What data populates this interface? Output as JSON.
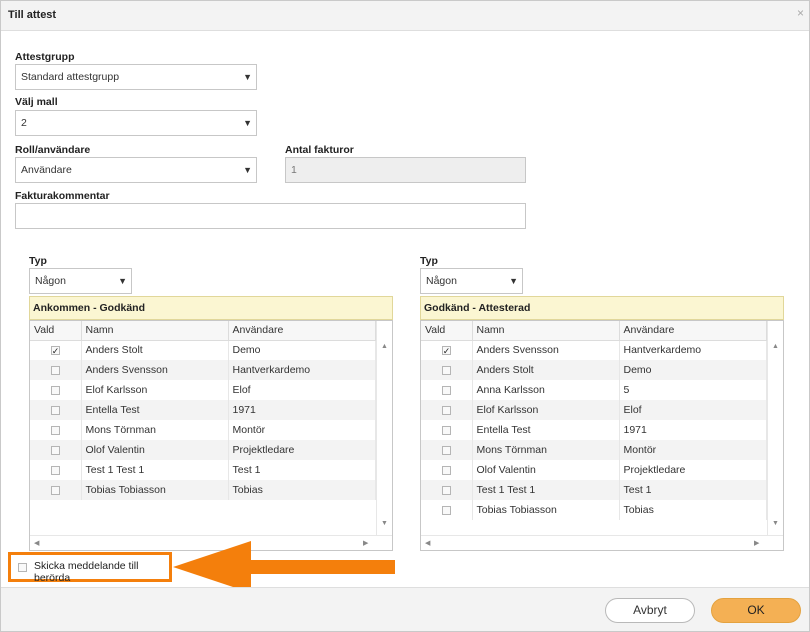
{
  "dialog": {
    "title": "Till attest",
    "close_glyph": "×"
  },
  "form": {
    "attestgrupp": {
      "label": "Attestgrupp",
      "value": "Standard attestgrupp"
    },
    "mall": {
      "label": "Välj mall",
      "value": "2"
    },
    "roll": {
      "label": "Roll/användare",
      "value": "Användare"
    },
    "antal": {
      "label": "Antal fakturor",
      "value": "1"
    },
    "kommentar": {
      "label": "Fakturakommentar",
      "value": ""
    }
  },
  "left_panel": {
    "typ_label": "Typ",
    "typ_value": "Någon",
    "header": "Ankommen - Godkänd",
    "columns": [
      "Vald",
      "Namn",
      "Användare"
    ],
    "rows": [
      {
        "checked": true,
        "namn": "Anders Stolt",
        "anvandare": "Demo"
      },
      {
        "checked": false,
        "namn": "Anders Svensson",
        "anvandare": "Hantverkardemo"
      },
      {
        "checked": false,
        "namn": "Elof Karlsson",
        "anvandare": "Elof"
      },
      {
        "checked": false,
        "namn": "Entella Test",
        "anvandare": "1971"
      },
      {
        "checked": false,
        "namn": "Mons Törnman",
        "anvandare": "Montör"
      },
      {
        "checked": false,
        "namn": "Olof Valentin",
        "anvandare": "Projektledare"
      },
      {
        "checked": false,
        "namn": "Test 1 Test 1",
        "anvandare": "Test 1"
      },
      {
        "checked": false,
        "namn": "Tobias Tobiasson",
        "anvandare": "Tobias"
      }
    ]
  },
  "right_panel": {
    "typ_label": "Typ",
    "typ_value": "Någon",
    "header": "Godkänd - Attesterad",
    "columns": [
      "Vald",
      "Namn",
      "Användare"
    ],
    "rows": [
      {
        "checked": true,
        "namn": "Anders Svensson",
        "anvandare": "Hantverkardemo"
      },
      {
        "checked": false,
        "namn": "Anders Stolt",
        "anvandare": "Demo"
      },
      {
        "checked": false,
        "namn": "Anna Karlsson",
        "anvandare": "5"
      },
      {
        "checked": false,
        "namn": "Elof Karlsson",
        "anvandare": "Elof"
      },
      {
        "checked": false,
        "namn": "Entella Test",
        "anvandare": "1971"
      },
      {
        "checked": false,
        "namn": "Mons Törnman",
        "anvandare": "Montör"
      },
      {
        "checked": false,
        "namn": "Olof Valentin",
        "anvandare": "Projektledare"
      },
      {
        "checked": false,
        "namn": "Test 1 Test 1",
        "anvandare": "Test 1"
      },
      {
        "checked": false,
        "namn": "Tobias Tobiasson",
        "anvandare": "Tobias"
      }
    ]
  },
  "notify": {
    "label": "Skicka meddelande till berörda",
    "checked": false
  },
  "buttons": {
    "cancel": "Avbryt",
    "ok": "OK"
  },
  "colors": {
    "highlight": "#f47f0c",
    "ok_button": "#f4b054",
    "group_header": "#fbf6d2"
  }
}
